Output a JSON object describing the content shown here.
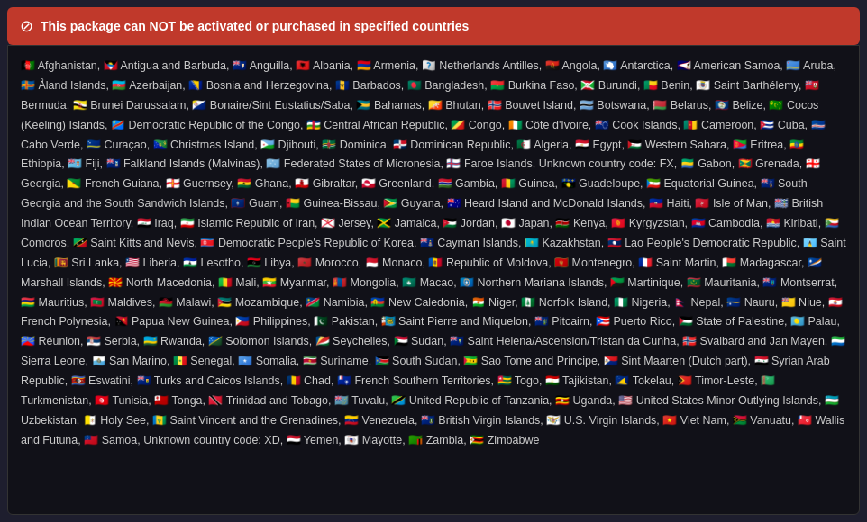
{
  "warning": {
    "icon": "⊘",
    "text": "This package can NOT be activated or purchased in specified countries"
  },
  "countries_raw": "🇦🇫 Afghanistan, 🇦🇬 Antigua and Barbuda, 🇦🇮 Anguilla, 🇦🇱 Albania, 🇦🇲 Armenia, 🇦🇳 Netherlands Antilles, 🇦🇴 Angola, 🇦🇶 Antarctica, 🇦🇸 American Samoa, 🇦🇼 Aruba, 🇦🇽 Åland Islands, 🇦🇿 Azerbaijan, 🇧🇦 Bosnia and Herzegovina, 🇧🇧 Barbados, 🇧🇩 Bangladesh, 🇧🇫 Burkina Faso, 🇧🇮 Burundi, 🇧🇯 Benin, 🇧🇱 Saint Barthélemy, 🇧🇲 Bermuda, 🇧🇳 Brunei Darussalam, 🇧🇶 Bonaire/Sint Eustatius/Saba, 🇧🇸 Bahamas, 🇧🇹 Bhutan, 🇧🇻 Bouvet Island, 🇧🇼 Botswana, 🇧🇾 Belarus, 🇧🇿 Belize, 🇨🇨 Cocos (Keeling) Islands, 🇨🇩 Democratic Republic of the Congo, 🇨🇫 Central African Republic, 🇨🇬 Congo, 🇨🇮 Côte d'Ivoire, 🇨🇰 Cook Islands, 🇨🇲 Cameroon, 🇨🇺 Cuba, 🇨🇻 Cabo Verde, 🇨🇼 Curaçao, 🇨🇽 Christmas Island, 🇩🇯 Djibouti, 🇩🇲 Dominica, 🇩🇴 Dominican Republic, 🇩🇿 Algeria, 🇪🇬 Egypt, 🇪🇭 Western Sahara, 🇪🇷 Eritrea, 🇪🇹 Ethiopia, 🇫🇯 Fiji, 🇫🇰 Falkland Islands (Malvinas), 🇫🇲 Federated States of Micronesia, 🇫🇴 Faroe Islands, Unknown country code: FX, 🇬🇦 Gabon, 🇬🇩 Grenada, 🇬🇪 Georgia, 🇬🇫 French Guiana, 🇬🇬 Guernsey, 🇬🇭 Ghana, 🇬🇮 Gibraltar, 🇬🇱 Greenland, 🇬🇲 Gambia, 🇬🇳 Guinea, 🇬🇵 Guadeloupe, 🇬🇶 Equatorial Guinea, 🇬🇸 South Georgia and the South Sandwich Islands, 🇬🇺 Guam, 🇬🇼 Guinea-Bissau, 🇬🇾 Guyana, 🇭🇲 Heard Island and McDonald Islands, 🇭🇹 Haiti, 🇮🇲 Isle of Man, 🇮🇴 British Indian Ocean Territory, 🇮🇶 Iraq, 🇮🇷 Islamic Republic of Iran, 🇯🇪 Jersey, 🇯🇲 Jamaica, 🇯🇴 Jordan, 🇯🇵 Japan, 🇰🇪 Kenya, 🇰🇬 Kyrgyzstan, 🇰🇭 Cambodia, 🇰🇮 Kiribati, 🇰🇲 Comoros, 🇰🇳 Saint Kitts and Nevis, 🇰🇵 Democratic People's Republic of Korea, 🇰🇾 Cayman Islands, 🇰🇿 Kazakhstan, 🇱🇦 Lao People's Democratic Republic, 🇱🇨 Saint Lucia, 🇱🇰 Sri Lanka, 🇱🇷 Liberia, 🇱🇸 Lesotho, 🇱🇾 Libya, 🇲🇦 Morocco, 🇲🇨 Monaco, 🇲🇩 Republic of Moldova, 🇲🇪 Montenegro, 🇲🇫 Saint Martin, 🇲🇬 Madagascar, 🇲🇭 Marshall Islands, 🇲🇰 North Macedonia, 🇲🇱 Mali, 🇲🇲 Myanmar, 🇲🇳 Mongolia, 🇲🇴 Macao, 🇲🇵 Northern Mariana Islands, 🇲🇶 Martinique, 🇲🇷 Mauritania, 🇲🇸 Montserrat, 🇲🇺 Mauritius, 🇲🇻 Maldives, 🇲🇼 Malawi, 🇲🇿 Mozambique, 🇳🇦 Namibia, 🇳🇨 New Caledonia, 🇳🇪 Niger, 🇳🇫 Norfolk Island, 🇳🇬 Nigeria, 🇳🇵 Nepal, 🇳🇷 Nauru, 🇳🇺 Niue, 🇵🇫 French Polynesia, 🇵🇬 Papua New Guinea, 🇵🇭 Philippines, 🇵🇰 Pakistan, 🇵🇲 Saint Pierre and Miquelon, 🇵🇳 Pitcairn, 🇵🇷 Puerto Rico, 🇵🇸 State of Palestine, 🇵🇼 Palau, 🇷🇪 Réunion, 🇷🇸 Serbia, 🇷🇼 Rwanda, 🇸🇧 Solomon Islands, 🇸🇨 Seychelles, 🇸🇩 Sudan, 🇸🇭 Saint Helena/Ascension/Tristan da Cunha, 🇸🇯 Svalbard and Jan Mayen, 🇸🇱 Sierra Leone, 🇸🇲 San Marino, 🇸🇳 Senegal, 🇸🇴 Somalia, 🇸🇷 Suriname, 🇸🇸 South Sudan, 🇸🇹 Sao Tome and Principe, 🇸🇽 Sint Maarten (Dutch part), 🇸🇾 Syrian Arab Republic, 🇸🇿 Eswatini, 🇹🇨 Turks and Caicos Islands, 🇹🇩 Chad, 🇹🇫 French Southern Territories, 🇹🇬 Togo, 🇹🇯 Tajikistan, 🇹🇰 Tokelau, 🇹🇱 Timor-Leste, 🇹🇲 Turkmenistan, 🇹🇳 Tunisia, 🇹🇴 Tonga, 🇹🇹 Trinidad and Tobago, 🇹🇻 Tuvalu, 🇹🇿 United Republic of Tanzania, 🇺🇬 Uganda, 🇺🇲 United States Minor Outlying Islands, 🇺🇿 Uzbekistan, 🇻🇦 Holy See, 🇻🇨 Saint Vincent and the Grenadines, 🇻🇪 Venezuela, 🇻🇬 British Virgin Islands, 🇻🇮 U.S. Virgin Islands, 🇻🇳 Viet Nam, 🇻🇺 Vanuatu, 🇼🇫 Wallis and Futuna, 🇼🇸 Samoa, Unknown country code: XD, 🇾🇪 Yemen, 🇾🇹 Mayotte, 🇿🇲 Zambia, 🇿🇼 Zimbabwe"
}
